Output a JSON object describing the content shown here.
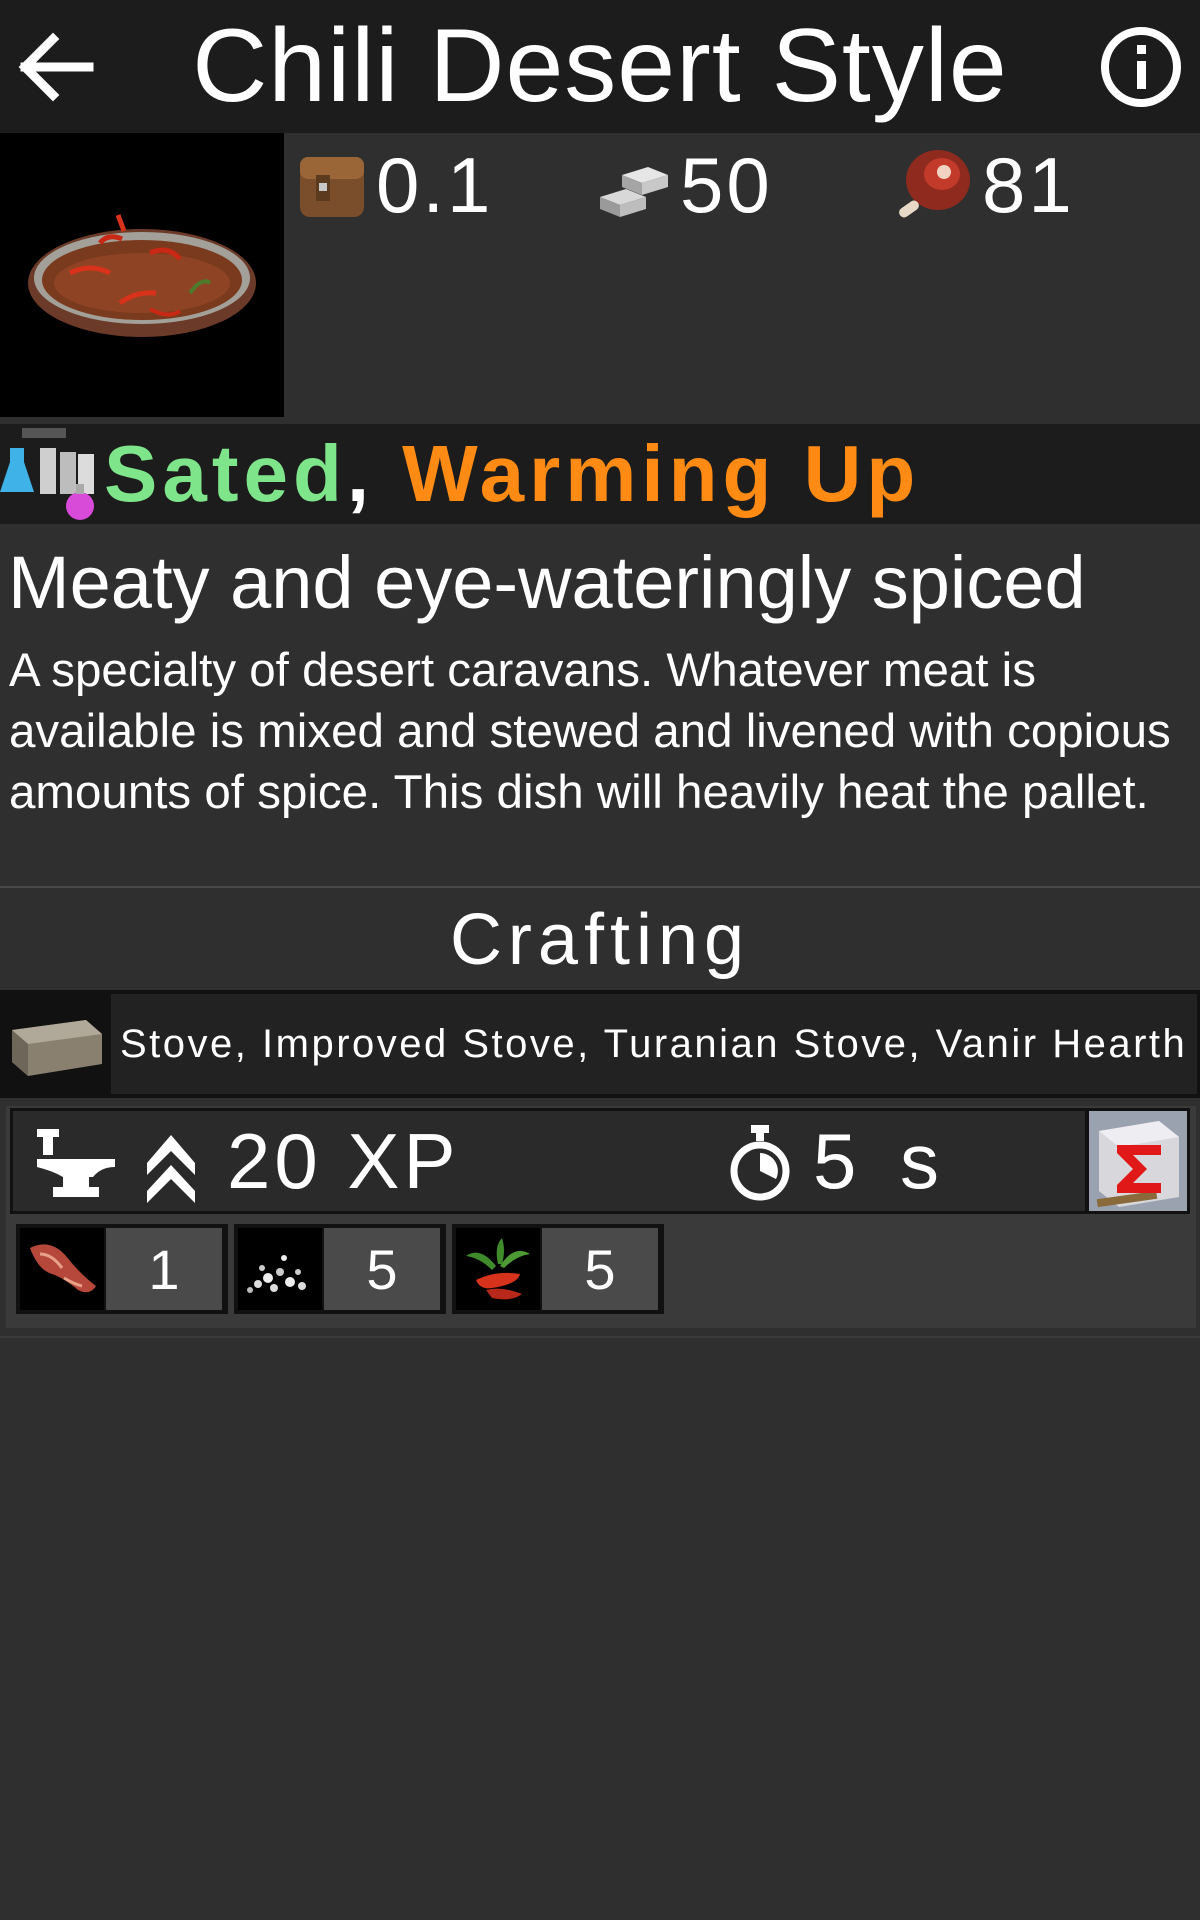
{
  "header": {
    "title": "Chili Desert Style",
    "back_icon": "arrow-left-icon",
    "info_icon": "info-icon"
  },
  "stats": {
    "weight": "0.1",
    "max_stack": "50",
    "food_value": "81"
  },
  "effects": {
    "primary": "Sated",
    "separator": ",",
    "secondary": "Warming Up",
    "colors": {
      "primary": "#7fe58a",
      "secondary": "#ff8a14"
    }
  },
  "subtitle": "Meaty and eye-wateringly spiced",
  "description": "A specialty of desert caravans. Whatever meat is available is mixed and stewed and livened with copious amounts of spice. This dish will heavily heat the pallet.",
  "crafting": {
    "title": "Crafting",
    "stations": "Stove, Improved Stove, Turanian Stove, Vanir Hearth",
    "xp": "20 XP",
    "time": "5 s",
    "ingredients": [
      {
        "icon": "meat-icon",
        "qty": "1"
      },
      {
        "icon": "spice-icon",
        "qty": "5"
      },
      {
        "icon": "chili-icon",
        "qty": "5"
      }
    ]
  }
}
